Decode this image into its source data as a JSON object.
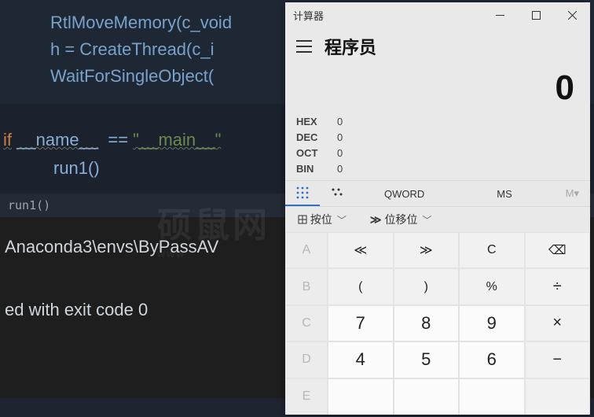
{
  "editor": {
    "line1": "RtlMoveMemory(c_void",
    "line2": "h = CreateThread(c_i",
    "line3": "WaitForSingleObject(",
    "if_keyword": "if",
    "name_var": "__name__",
    "eq": "==",
    "main_str": "\"__main__\"",
    "run_call": "run1()",
    "tab_label": "run1()",
    "terminal_line1": "Anaconda3\\envs\\ByPassAV",
    "terminal_line2": "ed with exit code 0"
  },
  "watermark": {
    "main": "硕鼠网",
    "sub": "www"
  },
  "calc": {
    "title": "计算器",
    "mode": "程序员",
    "display": "0",
    "bases": {
      "hex_label": "HEX",
      "hex_val": "0",
      "dec_label": "DEC",
      "dec_val": "0",
      "oct_label": "OCT",
      "oct_val": "0",
      "bin_label": "BIN",
      "bin_val": "0"
    },
    "toolbar": {
      "qword": "QWORD",
      "ms": "MS",
      "mclear": "M▾"
    },
    "subbar": {
      "byplace": "按位",
      "bitshift": "位移位"
    },
    "keys": {
      "A": "A",
      "B": "B",
      "C": "C",
      "D": "D",
      "E": "E",
      "lshift": "≪",
      "rshift": "≫",
      "clear": "C",
      "back": "⌫",
      "lparen": "(",
      "rparen": ")",
      "percent": "%",
      "div": "÷",
      "d7": "7",
      "d8": "8",
      "d9": "9",
      "mul": "×",
      "d4": "4",
      "d5": "5",
      "d6": "6",
      "minus": "−"
    }
  }
}
